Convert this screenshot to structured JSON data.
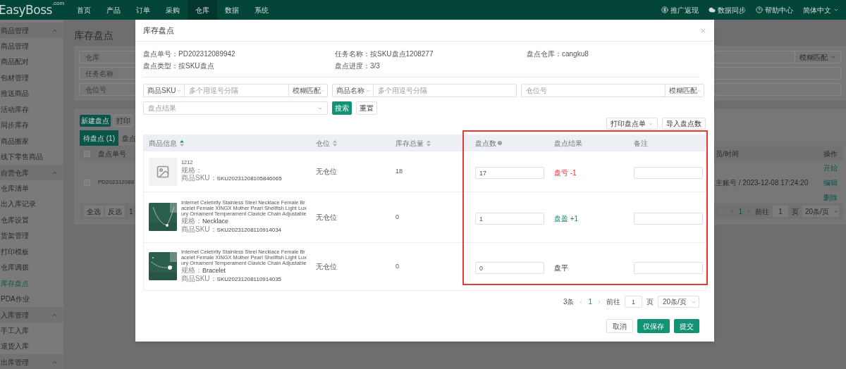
{
  "nav": {
    "logo": "EasyBoss",
    "logo_suffix": ".com",
    "items": [
      {
        "label": "首页",
        "selected": false
      },
      {
        "label": "产品",
        "selected": false
      },
      {
        "label": "订单",
        "selected": false
      },
      {
        "label": "采购",
        "selected": false
      },
      {
        "label": "仓库",
        "selected": true
      },
      {
        "label": "数据",
        "selected": false
      },
      {
        "label": "系统",
        "selected": false
      }
    ],
    "links": [
      {
        "label": "推广返现"
      },
      {
        "label": "数据同步"
      },
      {
        "label": "帮助中心"
      }
    ],
    "language": "简体中文"
  },
  "sidebar": {
    "groups": [
      {
        "title": "商品管理",
        "expanded": true,
        "items": [
          {
            "label": "商品管理",
            "selected": false
          },
          {
            "label": "商品配对",
            "selected": false
          },
          {
            "label": "包材管理",
            "selected": false
          },
          {
            "label": "推送商品",
            "selected": false
          },
          {
            "label": "活动库存",
            "selected": false
          },
          {
            "label": "同步库存",
            "selected": false
          },
          {
            "label": "商品搬家",
            "selected": false
          },
          {
            "label": "线下零售商品",
            "selected": false
          }
        ]
      },
      {
        "title": "自营仓库",
        "expanded": true,
        "items": [
          {
            "label": "仓库清单",
            "selected": false
          },
          {
            "label": "出入库记录",
            "selected": false
          },
          {
            "label": "仓库设置",
            "selected": false
          },
          {
            "label": "货架管理",
            "selected": false
          },
          {
            "label": "打印模板",
            "selected": false
          },
          {
            "label": "仓库调拨",
            "selected": false
          },
          {
            "label": "库存盘点",
            "selected": true
          },
          {
            "label": "PDA作业",
            "selected": false
          }
        ]
      },
      {
        "title": "入库管理",
        "expanded": true,
        "items": [
          {
            "label": "手工入库",
            "selected": false
          },
          {
            "label": "退货入库",
            "selected": false
          }
        ]
      },
      {
        "title": "出库管理",
        "expanded": true
      }
    ]
  },
  "page": {
    "title": "库存盘点",
    "filters": [
      {
        "placeholder": "仓库",
        "match": "模糊匹配"
      },
      {
        "placeholder": "任务名称"
      },
      {
        "placeholder": "仓位号"
      }
    ],
    "new_button": "新建盘点",
    "print_button": "打印",
    "tabs": [
      {
        "label": "待盘点 (1)",
        "selected": true
      },
      {
        "label": "盘点",
        "selected": false
      }
    ],
    "table": {
      "all_checked": false,
      "columns": [
        "盘点单号",
        "员/时间",
        "操作"
      ],
      "rows": [
        {
          "checked": false,
          "order_no": "PD202312088",
          "operator_time": "主账号 / 2023-12-08 17:24:20",
          "actions": [
            "开始",
            "编辑",
            "删除"
          ]
        }
      ]
    },
    "footer": {
      "buttons": [
        "全选",
        "反选"
      ],
      "count": "1",
      "pagination": {
        "page": "1",
        "goto": "前往",
        "goto_value": "1",
        "page_unit": "页",
        "page_size": "20条/页"
      }
    }
  },
  "dialog": {
    "title": "库存盘点",
    "info": [
      {
        "label": "盘点单号：",
        "value": "PD202312089942"
      },
      {
        "label": "任务名称：",
        "value": "按SKU盘点1208277"
      },
      {
        "label": "盘点仓库：",
        "value": "cangku8"
      },
      {
        "label": "盘点类型：",
        "value": "按SKU盘点"
      },
      {
        "label": "盘点进度：",
        "value": "3/3"
      }
    ],
    "filters": [
      {
        "select": "商品SKU",
        "placeholder": "多个用逗号分隔",
        "match": "模糊匹配"
      },
      {
        "select": "商品名称",
        "placeholder": "多个用逗号分隔"
      },
      {
        "placeholder": "仓位号",
        "match": "模糊匹配"
      }
    ],
    "result_filter": {
      "placeholder": "盘点结果"
    },
    "search_button": "搜索",
    "reset_button": "重置",
    "print_button": "打印盘点单",
    "import_button": "导入盘点数",
    "table": {
      "highlighted": true,
      "columns": [
        {
          "label": "商品信息",
          "sortable": true,
          "sorted": true
        },
        {
          "label": "仓位",
          "sortable": true,
          "sorted": false
        },
        {
          "label": "库存总量",
          "sortable": true,
          "sorted": false
        },
        {
          "label": "盘点数",
          "help": true
        },
        {
          "label": "盘点结果"
        },
        {
          "label": "备注"
        }
      ],
      "rows": [
        {
          "kind": "loss",
          "picture": false,
          "name": "1212",
          "spec_label": "规格：",
          "sku_label": "商品SKU：",
          "sku": "SKU20231208105846065",
          "location": "无仓位",
          "stock": "18",
          "count": "17",
          "result": "盘亏 -1"
        },
        {
          "kind": "gain",
          "picture": true,
          "name": "Internet Celebrity Stainless Steel Necklace Female Bracelet Female XINGX Mother Pearl Shellfish Light Luxury Ornament Temperament Clavicle Chain Adjustable",
          "spec_label": "规格：",
          "spec": "Necklace",
          "sku_label": "商品SKU：",
          "sku": "SKU20231208110914034",
          "location": "无仓位",
          "stock": "0",
          "count": "1",
          "result": "盘盈 +1"
        },
        {
          "kind": "even",
          "picture": true,
          "name": "Internet Celebrity Stainless Steel Necklace Female Bracelet Female XINGX Mother Pearl Shellfish Light Luxury Ornament Temperament Clavicle Chain Adjustable",
          "spec_label": "规格：",
          "spec": "Bracelet",
          "sku_label": "商品SKU：",
          "sku": "SKU20231208110914035",
          "location": "无仓位",
          "stock": "0",
          "count": "0",
          "result": "盘平"
        }
      ]
    },
    "pagination": {
      "total": "3条",
      "page": "1",
      "goto": "前往",
      "goto_value": "1",
      "page_unit": "页",
      "page_size": "20条/页"
    },
    "buttons": [
      {
        "label": "取消",
        "kind": "secondary"
      },
      {
        "label": "仅保存",
        "kind": "primary"
      },
      {
        "label": "提交",
        "kind": "primary"
      }
    ]
  }
}
